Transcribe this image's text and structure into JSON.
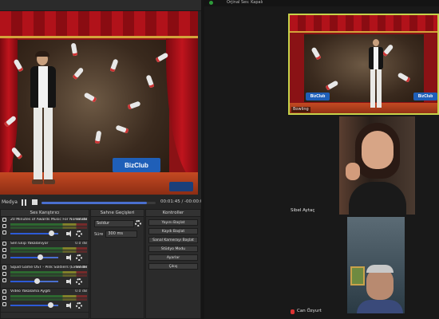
{
  "obs": {
    "transport": {
      "label": "Medya",
      "progress": 0.92,
      "time": "00:01:45 / -00:00:02"
    },
    "mixer": {
      "title": "Ses Karıştırıcı",
      "items": [
        {
          "name": "20 Minutes of Awards Music For Nomination",
          "db": "-inf dB",
          "volume": 0.85
        },
        {
          "name": "Sen Ekip Yakalanıyor",
          "db": "0.0 dB",
          "volume": 0.62
        },
        {
          "name": "Squid Game OST - Pink Soldiers (Extended)",
          "db": "-inf dB",
          "volume": 0.55
        },
        {
          "name": "Video Yakalama Aygıtı",
          "db": "0.0 dB",
          "volume": 0.84
        }
      ]
    },
    "transitions": {
      "title": "Sahne Geçişleri",
      "selected": "Soldur",
      "duration_label": "Süre",
      "duration_value": "300 ms"
    },
    "controls": {
      "title": "Kontroller",
      "buttons": [
        "Yayını Başlat",
        "Kaydı Başlat",
        "Sanal Kamerayı Başlat",
        "Stüdyo Modu",
        "Ayarlar",
        "Çıkış"
      ]
    },
    "preview_logo": "BizClub"
  },
  "meeting": {
    "top_label": "Orjinal Ses: Kapalı",
    "tiles": [
      {
        "name": "Bowling",
        "logo": "BizClub"
      },
      {
        "name": "Sibel Aytaç"
      },
      {
        "name": "Can Özyurt"
      }
    ]
  },
  "colors": {
    "accent_blue": "#2d5ad6",
    "active_speaker_border": "#c7d24a",
    "curtain_red": "#b1121a",
    "logo_blue": "#1f5fb8"
  }
}
